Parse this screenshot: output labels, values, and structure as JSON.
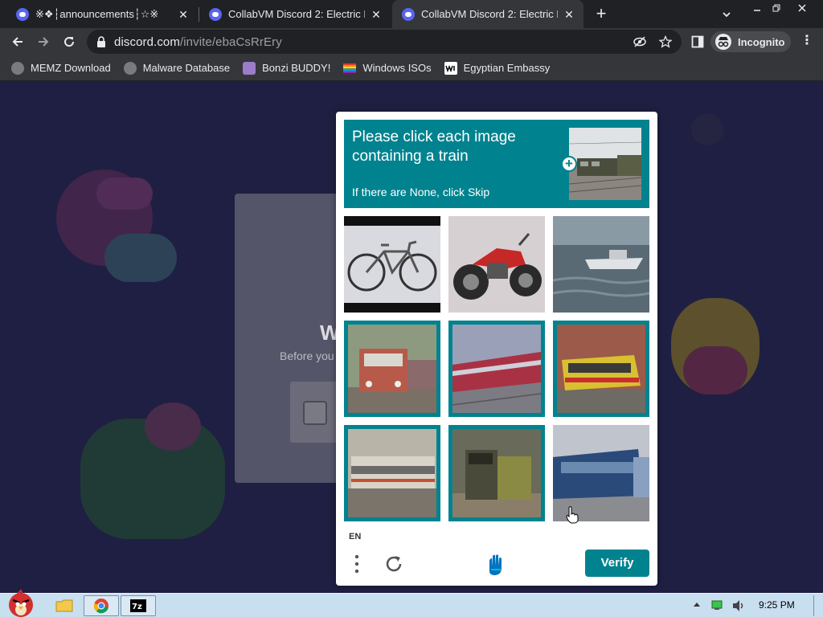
{
  "tabs": [
    {
      "title": "※❖┆announcements┆☆※",
      "active": false
    },
    {
      "title": "CollabVM Discord 2: Electric B",
      "active": false
    },
    {
      "title": "CollabVM Discord 2: Electric B",
      "active": true
    }
  ],
  "toolbar": {
    "url_host": "discord.com",
    "url_path": "/invite/ebaCsRrEry",
    "incognito_label": "Incognito"
  },
  "bookmarks": [
    {
      "label": "MEMZ Download"
    },
    {
      "label": "Malware Database"
    },
    {
      "label": "Bonzi BUDDY!"
    },
    {
      "label": "Windows ISOs"
    },
    {
      "label": "Egyptian Embassy"
    }
  ],
  "discord": {
    "heading": "W",
    "subtext": "Before you"
  },
  "captcha": {
    "prompt_title": "Please click each image containing a train",
    "prompt_sub": "If there are None, click Skip",
    "language": "EN",
    "verify_label": "Verify",
    "accent": "#00838f",
    "tiles": [
      {
        "subject": "bicycle",
        "selected": false
      },
      {
        "subject": "motorcycle",
        "selected": false
      },
      {
        "subject": "boat",
        "selected": false
      },
      {
        "subject": "train",
        "selected": true
      },
      {
        "subject": "train",
        "selected": true
      },
      {
        "subject": "train",
        "selected": true
      },
      {
        "subject": "train",
        "selected": true
      },
      {
        "subject": "train",
        "selected": true
      },
      {
        "subject": "train",
        "selected": false
      }
    ]
  },
  "taskbar": {
    "clock": "9:25 PM"
  }
}
